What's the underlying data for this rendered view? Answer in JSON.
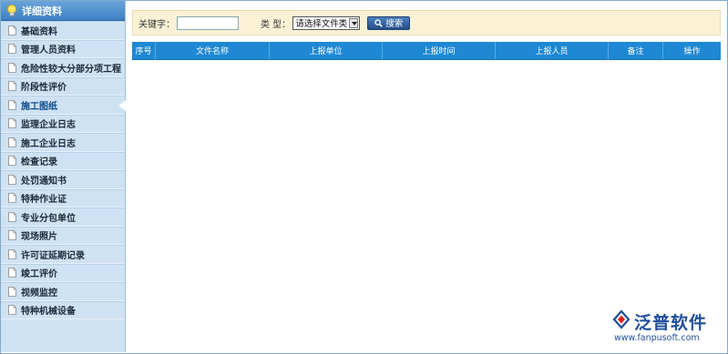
{
  "sidebar": {
    "title": "详细资料",
    "active_index": 4,
    "items": [
      {
        "label": "基础资料"
      },
      {
        "label": "管理人员资料"
      },
      {
        "label": "危险性较大分部分项工程"
      },
      {
        "label": "阶段性评价"
      },
      {
        "label": "施工图纸"
      },
      {
        "label": "监理企业日志"
      },
      {
        "label": "施工企业日志"
      },
      {
        "label": "检查记录"
      },
      {
        "label": "处罚通知书"
      },
      {
        "label": "特种作业证"
      },
      {
        "label": "专业分包单位"
      },
      {
        "label": "现场照片"
      },
      {
        "label": "许可证延期记录"
      },
      {
        "label": "竣工评价"
      },
      {
        "label": "视频监控"
      },
      {
        "label": "特种机械设备"
      }
    ]
  },
  "search": {
    "keyword_label": "关键字：",
    "keyword_value": "",
    "type_label": "类 型：",
    "type_selected": "请选择文件类",
    "search_button": "搜索"
  },
  "table": {
    "columns": [
      "序号",
      "文件名称",
      "上报单位",
      "上报时间",
      "上报人员",
      "备注",
      "操作"
    ],
    "rows": []
  },
  "watermark": {
    "brand": "泛普软件",
    "url": "www.fanpusoft.com"
  },
  "colors": {
    "sidebar_bg": "#cfe2f3",
    "header_blue": "#3d80c2",
    "table_header": "#1e88d4",
    "search_bg": "#fbf2d6",
    "brand_blue": "#1f4e9a"
  }
}
